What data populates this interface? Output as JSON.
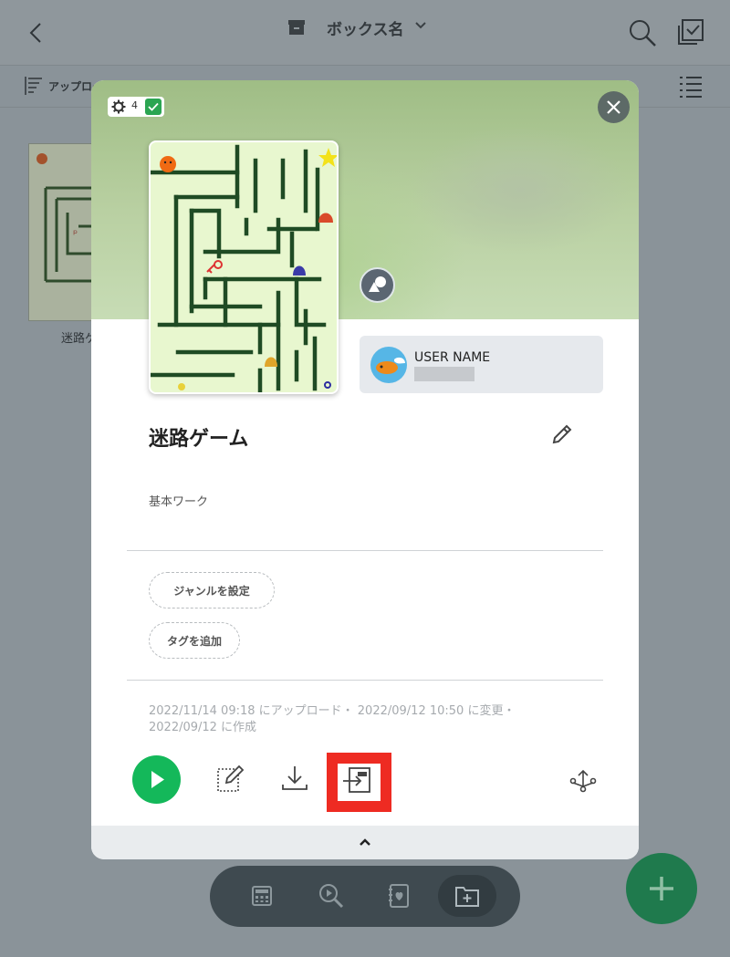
{
  "header": {
    "box_title": "ボックス名",
    "sort_label": "アップロー",
    "icons": [
      "back-icon",
      "box-icon",
      "chevron-down-icon",
      "search-icon",
      "select-checkbox-icon",
      "sort-icon",
      "list-view-icon"
    ]
  },
  "background_item": {
    "label": "迷路ゲ"
  },
  "modal": {
    "badge_count": "4",
    "user_name": "USER NAME",
    "title": "迷路ゲーム",
    "description": "基本ワーク",
    "genre_chip": "ジャンルを設定",
    "tag_chip": "タグを追加",
    "meta_line1": "2022/11/14 09:18 にアップロード・ 2022/09/12 10:50 に変更・",
    "meta_line2": "2022/09/12 に作成",
    "actions": [
      "play-icon",
      "edit-icon",
      "download-icon",
      "export-icon",
      "share-icon"
    ]
  },
  "colors": {
    "play_green": "#14b85a",
    "highlight_red": "#ee2b22",
    "fab_green": "#1f7a4d",
    "overlay_gray": "#8a9399"
  }
}
